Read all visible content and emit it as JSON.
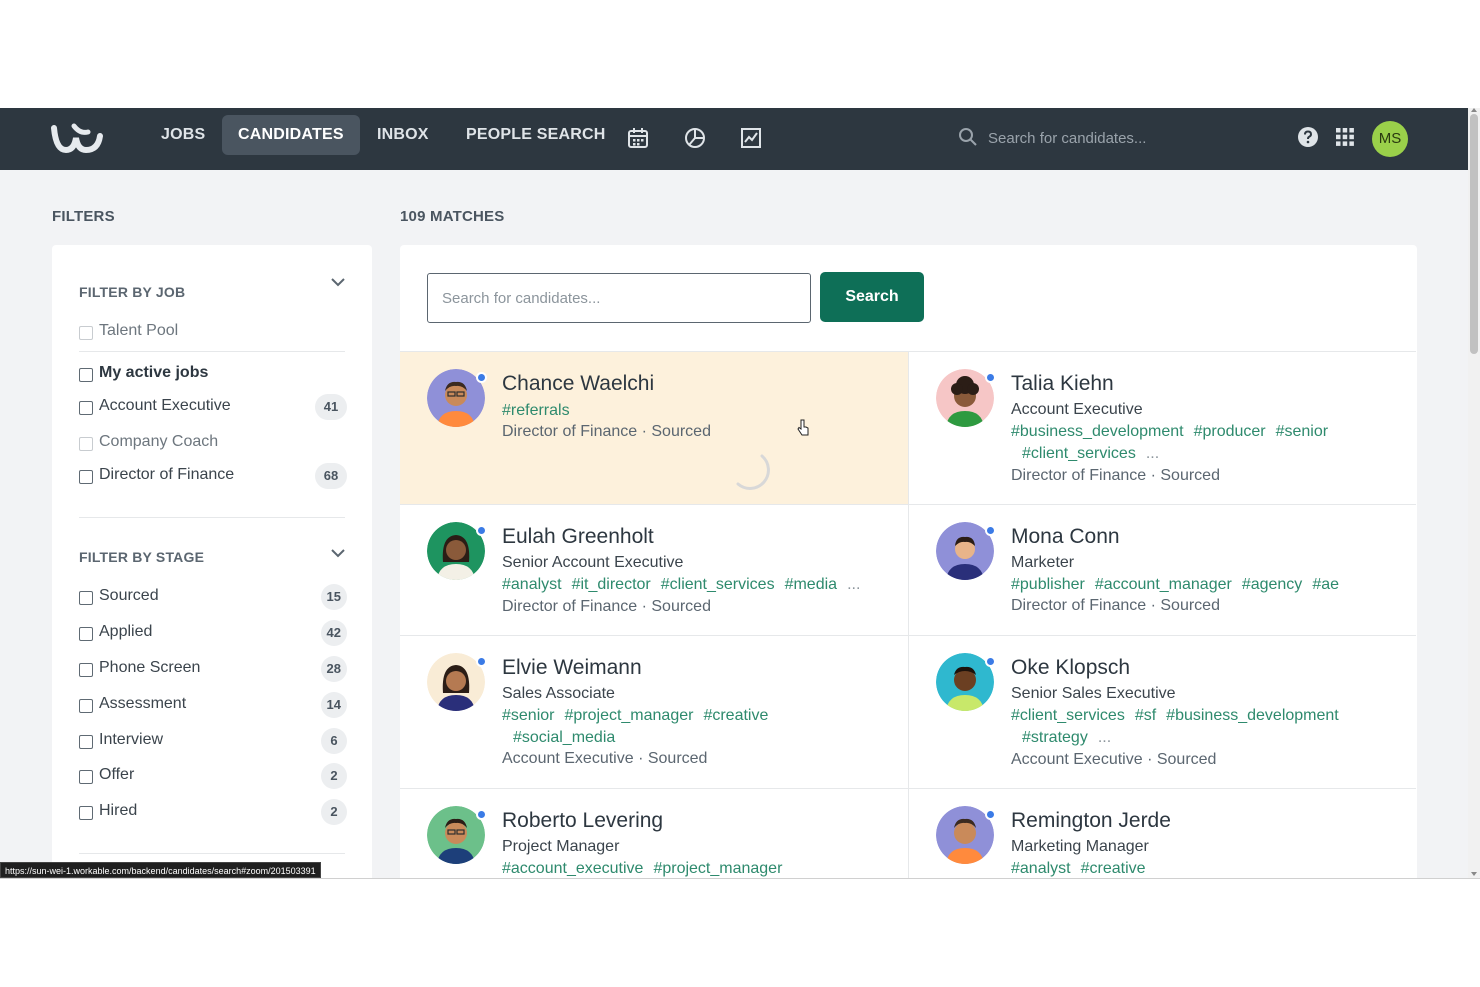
{
  "nav": {
    "items": [
      {
        "label": "JOBS",
        "active": false
      },
      {
        "label": "CANDIDATES",
        "active": true
      },
      {
        "label": "INBOX",
        "active": false
      },
      {
        "label": "PEOPLE SEARCH",
        "active": false
      }
    ],
    "icons": [
      "calendar-icon",
      "pie-chart-icon",
      "line-chart-icon"
    ],
    "search_placeholder": "Search for candidates...",
    "user_initials": "MS",
    "accent": "#2d3740"
  },
  "filters": {
    "title": "FILTERS",
    "by_job": {
      "heading": "FILTER BY JOB",
      "items": [
        {
          "label": "Talent Pool",
          "count": ""
        },
        {
          "label": "My active jobs",
          "count": ""
        },
        {
          "label": "Account Executive",
          "count": "41"
        },
        {
          "label": "Company Coach",
          "count": ""
        },
        {
          "label": "Director of Finance",
          "count": "68"
        }
      ]
    },
    "by_stage": {
      "heading": "FILTER BY STAGE",
      "items": [
        {
          "label": "Sourced",
          "count": "15"
        },
        {
          "label": "Applied",
          "count": "42"
        },
        {
          "label": "Phone Screen",
          "count": "28"
        },
        {
          "label": "Assessment",
          "count": "14"
        },
        {
          "label": "Interview",
          "count": "6"
        },
        {
          "label": "Offer",
          "count": "2"
        },
        {
          "label": "Hired",
          "count": "2"
        }
      ]
    }
  },
  "results": {
    "title": "109 MATCHES",
    "search_placeholder": "Search for candidates...",
    "search_button": "Search",
    "candidates": [
      {
        "name": "Chance Waelchi",
        "role": "",
        "tags": [
          "#referrals"
        ],
        "more": false,
        "stage": "Director of Finance · Sourced"
      },
      {
        "name": "Talia Kiehn",
        "role": "Account Executive",
        "tags": [
          "#business_development",
          "#producer",
          "#senior",
          "#client_services"
        ],
        "more": true,
        "stage": "Director of Finance · Sourced"
      },
      {
        "name": "Eulah Greenholt",
        "role": "Senior Account Executive",
        "tags": [
          "#analyst",
          "#it_director",
          "#client_services",
          "#media"
        ],
        "more": true,
        "stage": "Director of Finance · Sourced"
      },
      {
        "name": "Mona Conn",
        "role": "Marketer",
        "tags": [
          "#publisher",
          "#account_manager",
          "#agency",
          "#ae"
        ],
        "more": false,
        "stage": "Director of Finance · Sourced"
      },
      {
        "name": "Elvie Weimann",
        "role": "Sales Associate",
        "tags": [
          "#senior",
          "#project_manager",
          "#creative",
          "#social_media"
        ],
        "more": false,
        "stage": "Account Executive · Sourced"
      },
      {
        "name": "Oke Klopsch",
        "role": "Senior Sales Executive",
        "tags": [
          "#client_services",
          "#sf",
          "#business_development",
          "#strategy"
        ],
        "more": true,
        "stage": "Account Executive · Sourced"
      },
      {
        "name": "Roberto Levering",
        "role": "Project Manager",
        "tags": [
          "#account_executive",
          "#project_manager"
        ],
        "more": false,
        "stage": ""
      },
      {
        "name": "Remington Jerde",
        "role": "Marketing Manager",
        "tags": [
          "#analyst",
          "#creative"
        ],
        "more": false,
        "stage": ""
      }
    ],
    "ellipsis": "..."
  },
  "status_bar": {
    "url": "https://sun-wei-1.workable.com/backend/candidates/search#zoom/201503391"
  },
  "colors": {
    "tag_green": "#2e8a6d",
    "button_green": "#0e6f57",
    "highlight": "#fdf1dc",
    "online_dot": "#3b7be6"
  }
}
